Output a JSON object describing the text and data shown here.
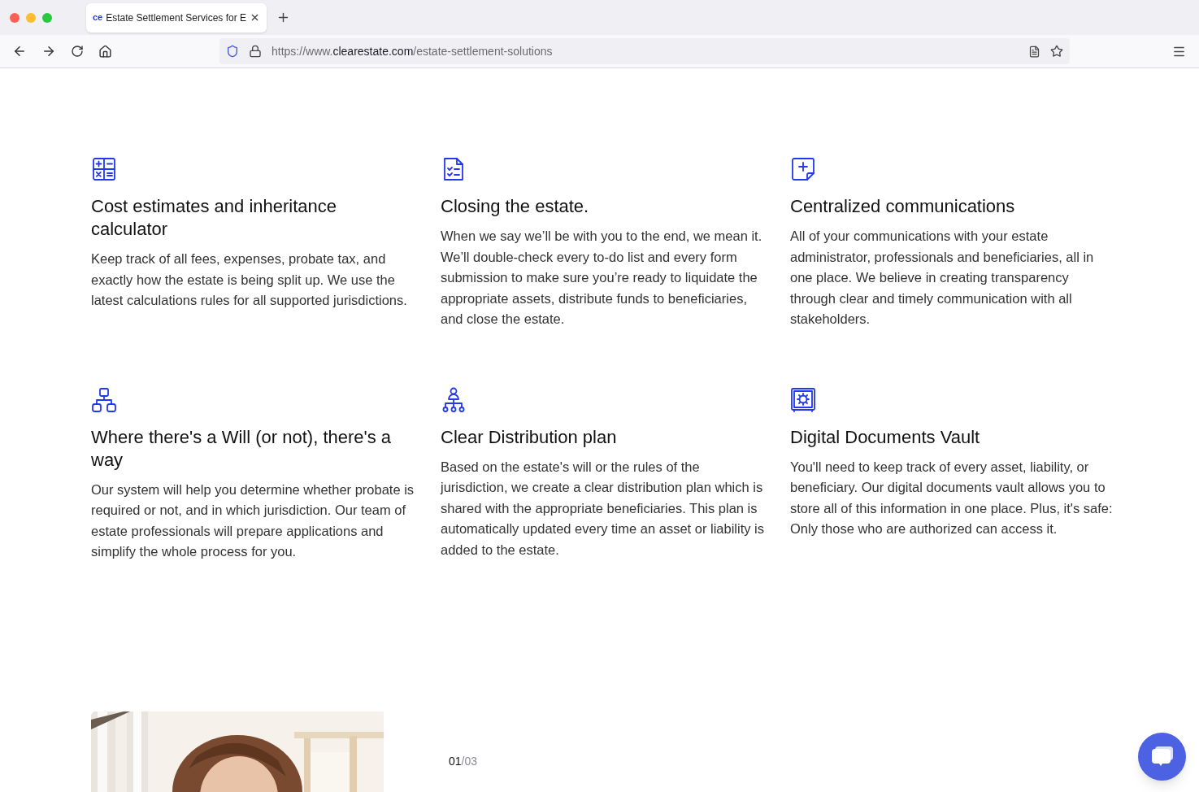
{
  "browser": {
    "tab": {
      "favicon_text": "ce",
      "title": "Estate Settlement Services for E"
    },
    "url": {
      "scheme": "https://www.",
      "domain": "clearestate.com",
      "path": "/estate-settlement-solutions"
    }
  },
  "features": [
    {
      "kind": "calculator",
      "title": "Cost estimates and inheritance calculator",
      "body": "Keep track of all fees, expenses, probate tax, and exactly how the estate is being split up. We use the latest calculations rules for all supported jurisdictions."
    },
    {
      "kind": "checklist",
      "title": "Closing the estate.",
      "body": "When we say we’ll be with you to the end, we mean it. We’ll double-check every to-do list and every form submission to make sure you’re ready to liquidate the appropriate assets, distribute funds to beneficiaries, and close the estate."
    },
    {
      "kind": "note",
      "title": "Centralized communications",
      "body": "All of your communications with your estate administrator, professionals and beneficiaries, all in one place. We believe in creating transparency through clear and timely communication with all stakeholders."
    },
    {
      "kind": "hierarchy",
      "title": "Where there's a Will (or not), there's a way",
      "body": "Our system will help you determine whether probate is required or not, and in which jurisdiction. Our team of estate professionals will prepare applications and simplify the whole process for you."
    },
    {
      "kind": "people",
      "title": "Clear Distribution plan",
      "body": "Based on the estate's will or the rules of the jurisdiction, we create a clear distribution plan which is shared with the appropriate beneficiaries. This plan is automatically updated every time an asset or liability is added to the estate."
    },
    {
      "kind": "vault",
      "title": "Digital Documents Vault",
      "body": "You'll need to keep track of every asset, liability, or beneficiary. Our digital documents vault allows you to store all of this information in one place. Plus, it's safe: Only those who are authorized can access it."
    }
  ],
  "slider": {
    "current": "01",
    "total": "/03"
  }
}
